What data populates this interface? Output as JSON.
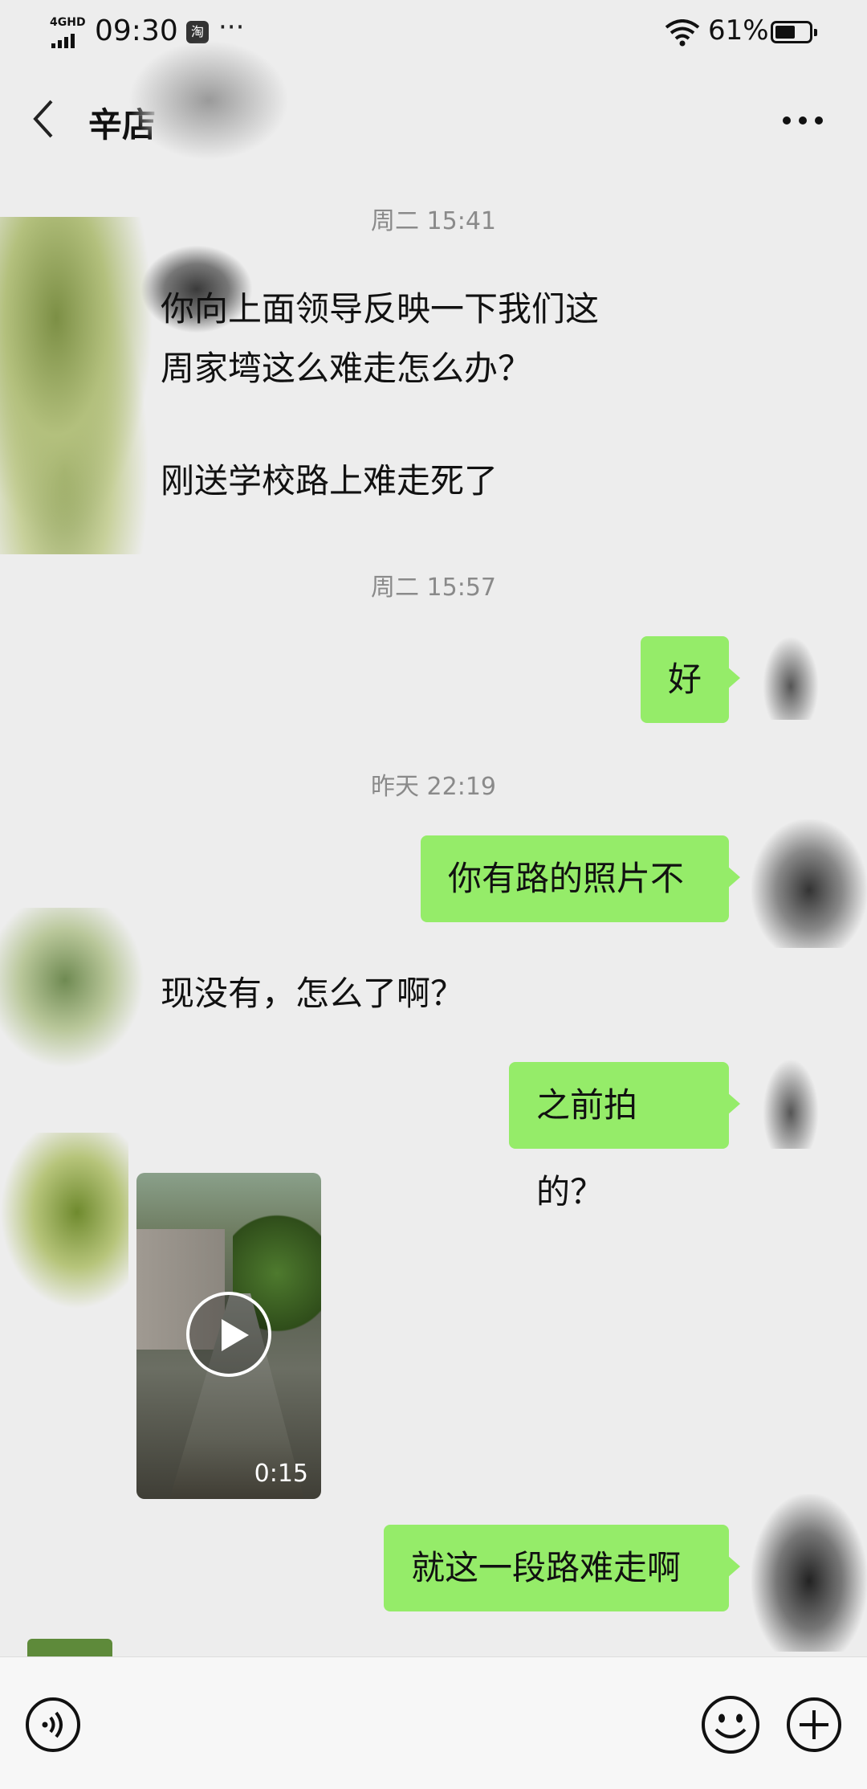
{
  "status_bar": {
    "network_label": "4GHD",
    "time": "09:30",
    "app_badge": "淘",
    "more": "···",
    "battery_percent": "61%",
    "battery_level": 0.61
  },
  "nav": {
    "title": "辛店",
    "more_icon": "more-dots-icon",
    "back_icon": "back-chevron-icon"
  },
  "messages": [
    {
      "type": "timestamp",
      "text": "周二 15:41"
    },
    {
      "type": "received_text",
      "lines": [
        "你向上面领导反映一下我们这",
        "周家塆这么难走怎么办？"
      ]
    },
    {
      "type": "received_text",
      "lines": [
        "刚送学校路上难走死了"
      ]
    },
    {
      "type": "timestamp",
      "text": "周二 15:57"
    },
    {
      "type": "sent_text",
      "text": "好"
    },
    {
      "type": "timestamp",
      "text": "昨天 22:19"
    },
    {
      "type": "sent_text",
      "text": "你有路的照片不"
    },
    {
      "type": "received_text",
      "lines": [
        "现没有，怎么了啊？"
      ]
    },
    {
      "type": "sent_text",
      "text": "之前拍的？"
    },
    {
      "type": "received_video",
      "duration": "0:15"
    },
    {
      "type": "sent_text",
      "text": "就这一段路难走啊"
    }
  ],
  "input_bar": {
    "voice_icon": "voice-icon",
    "emoji_icon": "emoji-icon",
    "plus_icon": "plus-icon"
  },
  "colors": {
    "background": "#ededed",
    "sent_bubble": "#95ec69",
    "timestamp_text": "#8a8a8a"
  }
}
